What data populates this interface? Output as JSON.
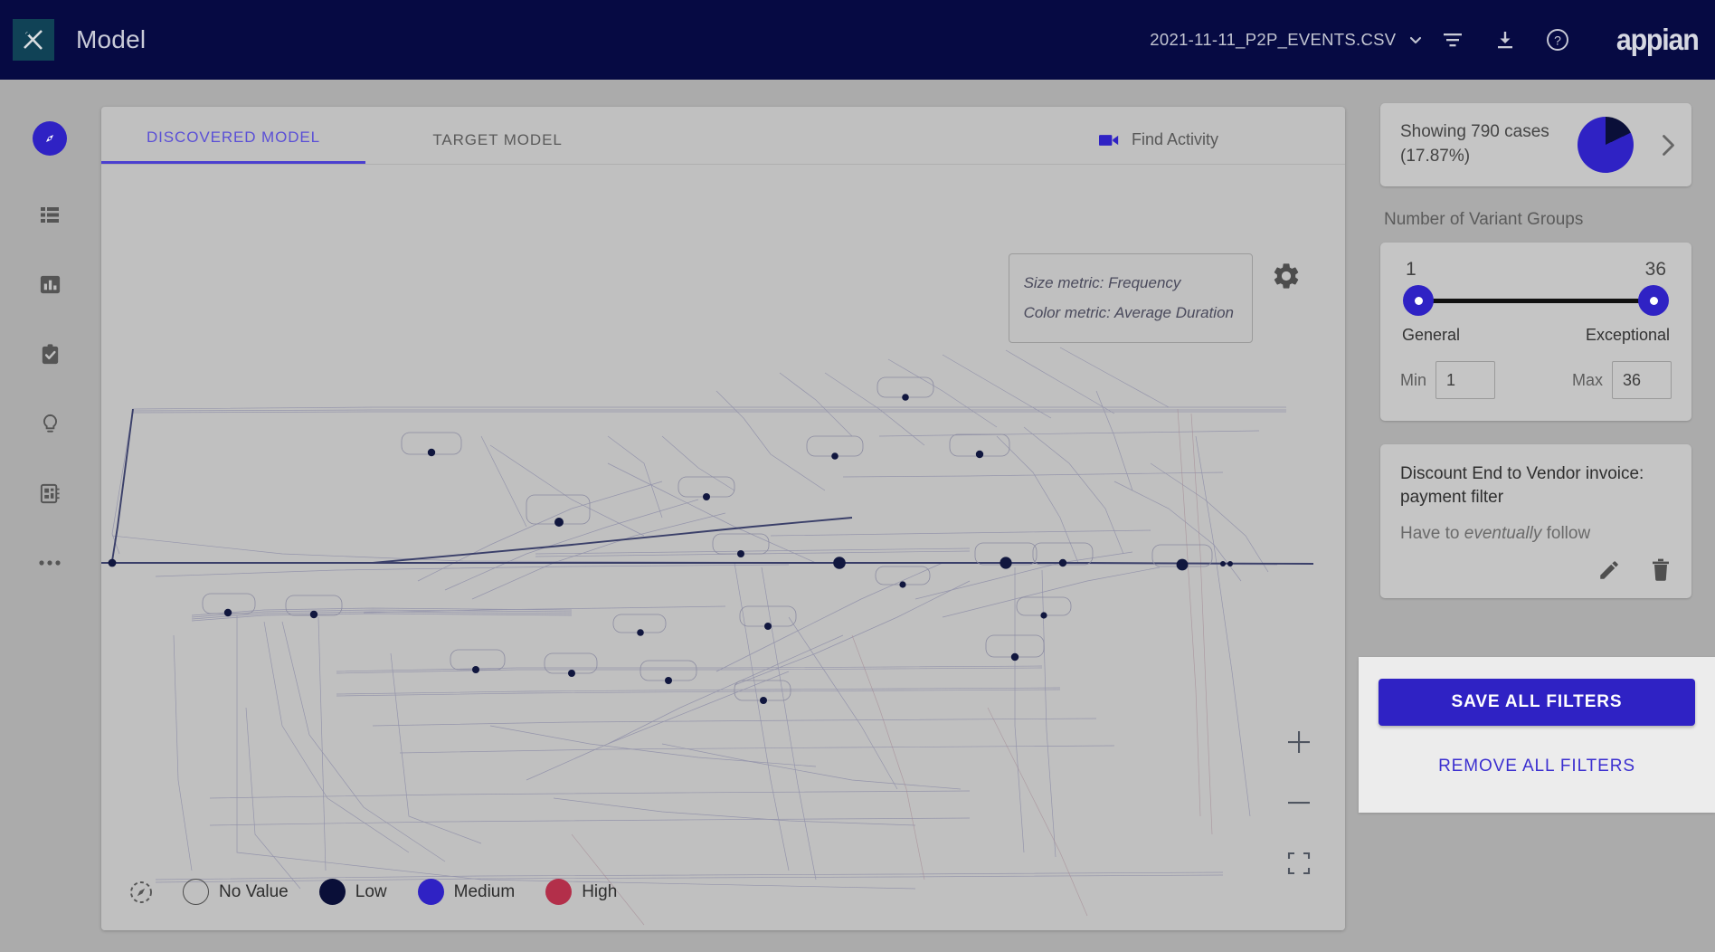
{
  "header": {
    "logo_icon": "appian-k-logo-icon",
    "title": "Model",
    "file_name": "2021-11-11_P2P_EVENTS.CSV",
    "chevron_icon": "chevron-down-icon",
    "filter_icon": "filter-icon",
    "download_icon": "download-icon",
    "help_icon": "help-circle-icon",
    "brand": "appian",
    "bg_color": "#060a43"
  },
  "sidebar": {
    "items": [
      {
        "name": "compass-icon",
        "label": "Discover",
        "active": true
      },
      {
        "name": "list-icon",
        "label": "List",
        "active": false
      },
      {
        "name": "bar-chart-icon",
        "label": "Analytics",
        "active": false
      },
      {
        "name": "clipboard-check-icon",
        "label": "Conformance",
        "active": false
      },
      {
        "name": "lightbulb-icon",
        "label": "Insights",
        "active": false
      },
      {
        "name": "contact-book-icon",
        "label": "Data",
        "active": false
      },
      {
        "name": "more-horizontal-icon",
        "label": "More",
        "active": false
      }
    ]
  },
  "main": {
    "tabs": [
      {
        "label": "DISCOVERED MODEL",
        "active": true
      },
      {
        "label": "TARGET MODEL",
        "active": false
      }
    ],
    "find_activity": {
      "icon": "video-camera-icon",
      "label": "Find Activity"
    },
    "metric_box": {
      "size_metric": "Size metric: Frequency",
      "color_metric": "Color metric: Average Duration"
    },
    "settings_icon": "gear-icon",
    "zoom_controls": {
      "zoom_in": "plus-icon",
      "zoom_out": "minus-icon",
      "fit_screen": "fullscreen-icon"
    },
    "legend": {
      "reset_icon": "reset-compass-icon",
      "items": [
        {
          "label": "No Value",
          "color": "transparent"
        },
        {
          "label": "Low",
          "color": "#0a0f38"
        },
        {
          "label": "Medium",
          "color": "#2f22c4"
        },
        {
          "label": "High",
          "color": "#b32f4a"
        }
      ]
    }
  },
  "right_panel": {
    "cases": {
      "line1": "Showing 790 cases",
      "line2": "(17.87%)",
      "pie_percent": 17.87,
      "pie_fill_color": "#2f22c4",
      "pie_slice_color": "#0a0f38",
      "chevron_icon": "chevron-right-icon"
    },
    "variant_groups": {
      "title": "Number of Variant Groups",
      "value_min": "1",
      "value_max": "36",
      "label_left": "General",
      "label_right": "Exceptional",
      "min_label": "Min",
      "min_value": "1",
      "max_label": "Max",
      "max_value": "36"
    },
    "filter": {
      "title": "Discount End to Vendor invoice: payment filter",
      "subtitle_prefix": "Have to ",
      "subtitle_em": "eventually",
      "subtitle_suffix": " follow",
      "edit_icon": "pencil-icon",
      "delete_icon": "trash-icon"
    },
    "actions": {
      "save_label": "SAVE ALL FILTERS",
      "remove_label": "REMOVE ALL FILTERS",
      "primary_color": "#2f22c4"
    }
  },
  "colors": {
    "app_bg": "#ababab",
    "card_bg": "#c0c0c0",
    "accent": "#2f22c4",
    "header_bg": "#060a43"
  }
}
